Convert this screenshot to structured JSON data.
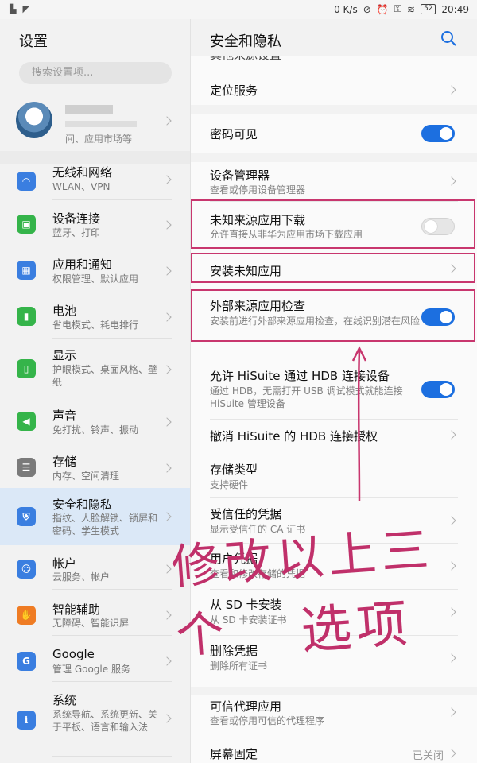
{
  "status_bar": {
    "speed": "0 K/s",
    "battery": "52",
    "time": "20:49"
  },
  "left": {
    "title": "设置",
    "search_placeholder": "搜索设置项...",
    "profile_sub": "间、应用市场等",
    "items": [
      {
        "label": "无线和网络",
        "sub": "WLAN、VPN",
        "icon": "wifi-icon",
        "color": "#3a7ee0"
      },
      {
        "label": "设备连接",
        "sub": "蓝牙、打印",
        "icon": "device-connection-icon",
        "color": "#35b44a"
      },
      {
        "label": "应用和通知",
        "sub": "权限管理、默认应用",
        "icon": "apps-icon",
        "color": "#3a7ee0"
      },
      {
        "label": "电池",
        "sub": "省电模式、耗电排行",
        "icon": "battery-icon",
        "color": "#35b44a"
      },
      {
        "label": "显示",
        "sub": "护眼模式、桌面风格、壁纸",
        "icon": "display-icon",
        "color": "#35b44a"
      },
      {
        "label": "声音",
        "sub": "免打扰、铃声、振动",
        "icon": "sound-icon",
        "color": "#35b44a"
      },
      {
        "label": "存储",
        "sub": "内存、空间清理",
        "icon": "storage-icon",
        "color": "#7a7a7a"
      },
      {
        "label": "安全和隐私",
        "sub": "指纹、人脸解锁、锁屏和密码、学生模式",
        "icon": "shield-icon",
        "color": "#3a7ee0"
      },
      {
        "label": "帐户",
        "sub": "云服务、帐户",
        "icon": "account-icon",
        "color": "#3a7ee0"
      },
      {
        "label": "智能辅助",
        "sub": "无障碍、智能识屏",
        "icon": "hand-icon",
        "color": "#ef7c24"
      },
      {
        "label": "Google",
        "sub": "管理 Google 服务",
        "icon": "google-icon",
        "color": "#3a7ee0"
      },
      {
        "label": "系统",
        "sub": "系统导航、系统更新、关于平板、语言和输入法",
        "icon": "system-icon",
        "color": "#3a7ee0"
      }
    ]
  },
  "right": {
    "title": "安全和隐私",
    "partial_top": "其他来源设置",
    "location": "定位服务",
    "password_visible": "密码可见",
    "device_admin": {
      "title": "设备管理器",
      "sub": "查看或停用设备管理器"
    },
    "unknown_download": {
      "title": "未知来源应用下载",
      "sub": "允许直接从非华为应用市场下载应用",
      "on": false
    },
    "install_unknown": "安装未知应用",
    "external_check": {
      "title": "外部来源应用检查",
      "sub": "安装前进行外部来源应用检查，在线识别潜在风险",
      "on": true
    },
    "hisuite_hdb": {
      "title": "允许 HiSuite 通过 HDB 连接设备",
      "sub": "通过 HDB，无需打开 USB 调试模式就能连接 HiSuite 管理设备",
      "on": true
    },
    "revoke_hdb": "撤消 HiSuite 的 HDB 连接授权",
    "storage_type": {
      "title": "存储类型",
      "sub": "支持硬件"
    },
    "trusted_creds": {
      "title": "受信任的凭据",
      "sub": "显示受信任的 CA 证书"
    },
    "user_creds": {
      "title": "用户凭据",
      "sub": "查看和修改存储的凭据"
    },
    "sd_install": {
      "title": "从 SD 卡安装",
      "sub": "从 SD 卡安装证书"
    },
    "delete_creds": {
      "title": "删除凭据",
      "sub": "删除所有证书"
    },
    "trust_agents": {
      "title": "可信代理应用",
      "sub": "查看或停用可信的代理程序"
    },
    "screen_pin": {
      "title": "屏幕固定",
      "value": "已关闭"
    }
  },
  "annotation": {
    "line1": "修改以上三个",
    "line2": "选项",
    "color": "#c8366e"
  }
}
